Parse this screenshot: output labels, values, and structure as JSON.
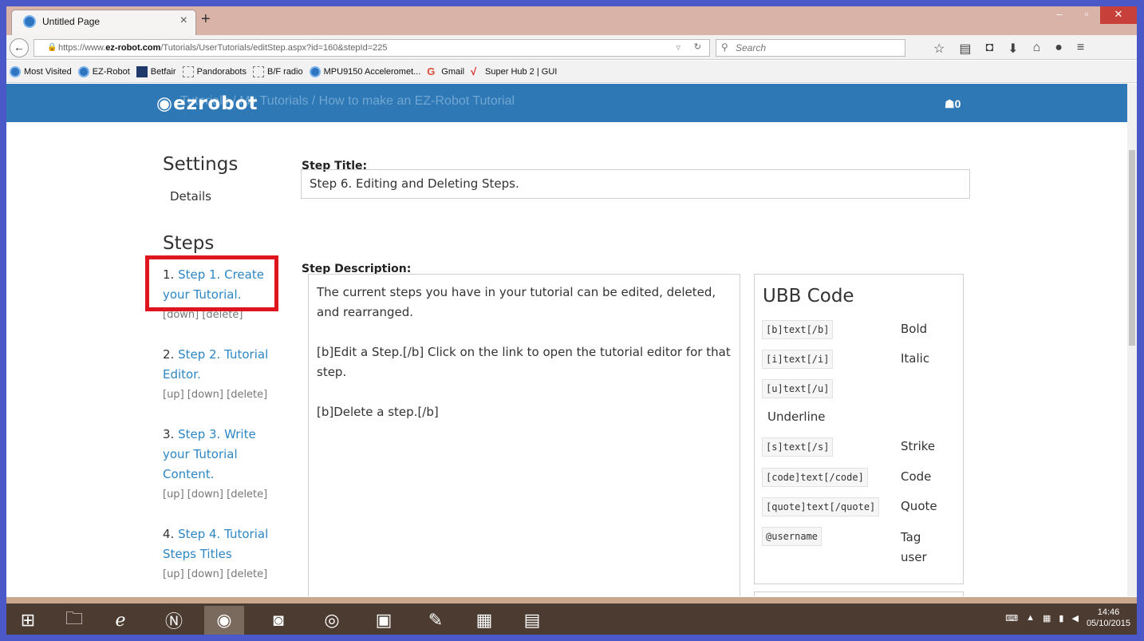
{
  "browser": {
    "tab_title": "Untitled Page",
    "tab_close": "×",
    "new_tab": "+",
    "window": {
      "minimize": "–",
      "restore": "▫",
      "close": "✕"
    },
    "url_prefix": "https://www.",
    "url_domain": "ez-robot.com",
    "url_path": "/Tutorials/UserTutorials/editStep.aspx?id=160&stepId=225",
    "search_placeholder": "Search",
    "bookmarks": [
      {
        "label": "Most Visited",
        "icon": "firefox-icon"
      },
      {
        "label": "EZ-Robot",
        "icon": "ezrobot-icon"
      },
      {
        "label": "Betfair",
        "icon": "betfair-icon"
      },
      {
        "label": "Pandorabots",
        "icon": "folder-icon"
      },
      {
        "label": "B/F radio",
        "icon": "folder-icon"
      },
      {
        "label": "MPU9150 Acceleromet...",
        "icon": "ezrobot-icon"
      },
      {
        "label": "Gmail",
        "icon": "google-icon"
      },
      {
        "label": "Super Hub 2 | GUI",
        "icon": "checkmark-icon"
      }
    ]
  },
  "site": {
    "logo": "ezrobot",
    "breadcrumb": "Tutorials / My Tutorials / How to make an EZ-Robot Tutorial",
    "cart_count": "0"
  },
  "sidebar": {
    "settings_heading": "Settings",
    "details_link": "Details",
    "steps_heading": "Steps",
    "steps": [
      {
        "num": "1.",
        "title": "Step 1. Create your Tutorial.",
        "controls": "[down] [delete]"
      },
      {
        "num": "2.",
        "title": "Step 2. Tutorial Editor.",
        "controls": "[up] [down] [delete]"
      },
      {
        "num": "3.",
        "title": "Step 3. Write your Tutorial Content.",
        "controls": "[up] [down] [delete]"
      },
      {
        "num": "4.",
        "title": "Step 4. Tutorial Steps Titles",
        "controls": "[up] [down] [delete]"
      }
    ]
  },
  "form": {
    "step_title_label": "Step Title:",
    "step_title_value": "Step 6. Editing and Deleting Steps.",
    "step_desc_label": "Step Description:",
    "step_desc_value": "The current steps you have in your tutorial can be edited, deleted, and rearranged.\n\n[b]Edit a Step.[/b] Click on the link to open the tutorial editor for that step.\n\n[b]Delete a step.[/b]"
  },
  "ubb": {
    "title": "UBB Code",
    "codes": [
      {
        "code": "[b]text[/b]",
        "desc": "Bold"
      },
      {
        "code": "[i]text[/i]",
        "desc": "Italic"
      },
      {
        "code": "[u]text[/u]",
        "desc": "Underline"
      },
      {
        "code": "[s]text[/s]",
        "desc": "Strike"
      },
      {
        "code": "[code]text[/code]",
        "desc": "Code"
      },
      {
        "code": "[quote]text[/quote]",
        "desc": "Quote"
      },
      {
        "code": "@username",
        "desc": "Tag user"
      }
    ]
  },
  "taskbar": {
    "time": "14:46",
    "date": "05/10/2015"
  },
  "colors": {
    "site_header": "#2f78b6",
    "link": "#2d86c4",
    "highlight": "#e0141c"
  }
}
